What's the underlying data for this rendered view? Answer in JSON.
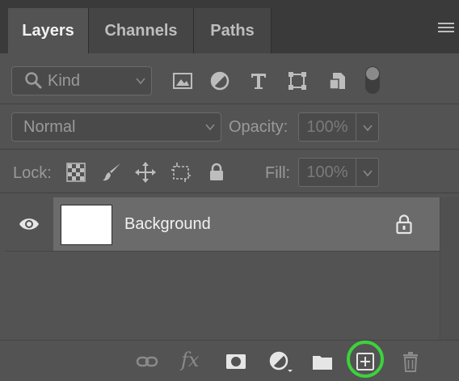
{
  "tabs": [
    {
      "label": "Layers",
      "active": true
    },
    {
      "label": "Channels",
      "active": false
    },
    {
      "label": "Paths",
      "active": false
    }
  ],
  "filter": {
    "kind_label": "Kind",
    "icons": [
      "image-filter-icon",
      "adjustment-filter-icon",
      "type-filter-icon",
      "shape-filter-icon",
      "smart-object-filter-icon"
    ]
  },
  "blend": {
    "mode": "Normal",
    "opacity_label": "Opacity:",
    "opacity_value": "100%"
  },
  "lock": {
    "label": "Lock:",
    "fill_label": "Fill:",
    "fill_value": "100%",
    "icons": [
      "lock-transparent-pixels-icon",
      "lock-image-pixels-icon",
      "lock-position-icon",
      "lock-artboard-icon",
      "lock-all-icon"
    ]
  },
  "layers": [
    {
      "name": "Background",
      "visible": true,
      "locked": true
    }
  ],
  "bottom_bar": {
    "fx_label": "fx",
    "icons": [
      "link-layers-icon",
      "fx-icon",
      "add-mask-icon",
      "new-adjustment-layer-icon",
      "new-group-icon",
      "new-layer-icon",
      "delete-layer-icon"
    ],
    "highlighted": "new-layer-icon",
    "highlight_color": "#3cd23c"
  }
}
